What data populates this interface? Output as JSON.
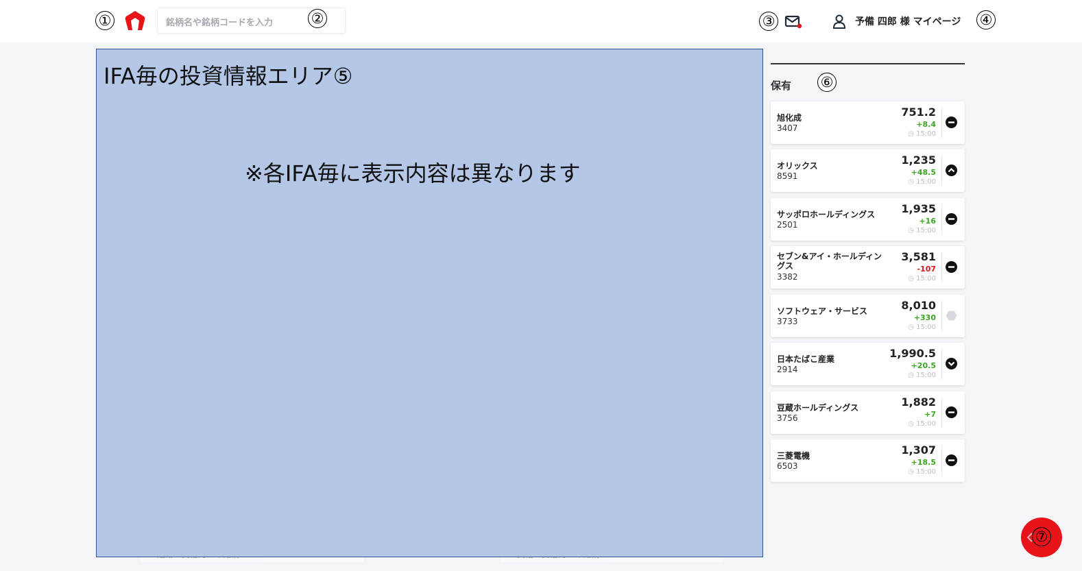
{
  "markers": [
    "①",
    "②",
    "③",
    "④",
    "⑤",
    "⑥",
    "⑦"
  ],
  "header": {
    "search_placeholder": "銘柄名や銘柄コードを入力",
    "user_label": "予備 四郎 様 マイページ"
  },
  "ifa_area": {
    "title": "IFA毎の投資情報エリア⑤",
    "note": "※各IFA毎に表示内容は異なります"
  },
  "background_hint": {
    "left_text": "通常　貸借対　の銘柄",
    "right_text": "貸借　貸借対　の銘柄"
  },
  "holdings": {
    "title": "保有",
    "items": [
      {
        "name": "旭化成",
        "code": "3407",
        "price": "751.2",
        "change": "+8.4",
        "direction": "up",
        "time": "◷ 15:00",
        "trend_icon": "flat-icon"
      },
      {
        "name": "オリックス",
        "code": "8591",
        "price": "1,235",
        "change": "+48.5",
        "direction": "up",
        "time": "◷ 15:00",
        "trend_icon": "up-icon"
      },
      {
        "name": "サッポロホールディングス",
        "code": "2501",
        "price": "1,935",
        "change": "+16",
        "direction": "up",
        "time": "◷ 15:00",
        "trend_icon": "flat-icon"
      },
      {
        "name": "セブン&アイ・ホールディングス",
        "code": "3382",
        "price": "3,581",
        "change": "-107",
        "direction": "down",
        "time": "◷ 15:00",
        "trend_icon": "flat-icon"
      },
      {
        "name": "ソフトウェア・サービス",
        "code": "3733",
        "price": "8,010",
        "change": "+330",
        "direction": "up",
        "time": "◷ 15:00",
        "trend_icon": "hexagon-icon"
      },
      {
        "name": "日本たばこ産業",
        "code": "2914",
        "price": "1,990.5",
        "change": "+20.5",
        "direction": "up",
        "time": "◷ 15:00",
        "trend_icon": "down-icon"
      },
      {
        "name": "豆蔵ホールディングス",
        "code": "3756",
        "price": "1,882",
        "change": "+7",
        "direction": "up",
        "time": "◷ 15:00",
        "trend_icon": "flat-icon"
      },
      {
        "name": "三菱電機",
        "code": "6503",
        "price": "1,307",
        "change": "+18.5",
        "direction": "up",
        "time": "◷ 15:00",
        "trend_icon": "flat-icon"
      }
    ]
  },
  "colors": {
    "brand": "#e8141a",
    "up": "#3aa51f",
    "down": "#d8151d",
    "ifa_fill": "#b4c7e7"
  }
}
